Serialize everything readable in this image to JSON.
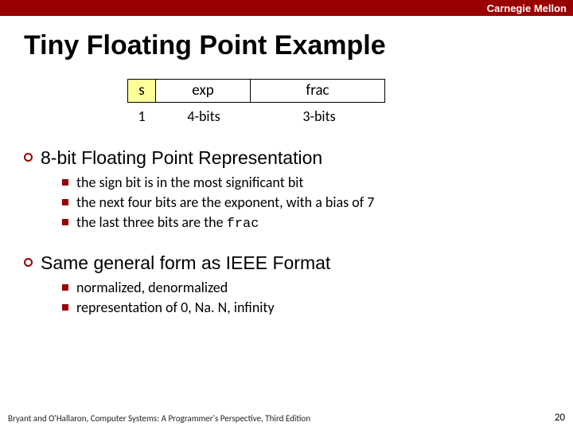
{
  "header": {
    "brand": "Carnegie Mellon"
  },
  "title": "Tiny Floating Point Example",
  "diagram": {
    "fields": {
      "s": "s",
      "exp": "exp",
      "frac": "frac"
    },
    "widths": {
      "s": "1",
      "exp": "4-bits",
      "frac": "3-bits"
    }
  },
  "points": [
    {
      "heading": "8-bit Floating Point Representation",
      "items": [
        {
          "text": "the sign bit is in the most significant bit"
        },
        {
          "text": "the next four bits are the exponent, with a bias of 7"
        },
        {
          "prefix": "the last three bits are the ",
          "mono": "frac"
        }
      ]
    },
    {
      "heading": "Same general form as IEEE Format",
      "items": [
        {
          "text": "normalized, denormalized"
        },
        {
          "text": "representation of 0, Na. N, infinity"
        }
      ]
    }
  ],
  "footer": {
    "attribution": "Bryant and O'Hallaron, Computer Systems: A Programmer's Perspective, Third Edition",
    "page": "20"
  }
}
